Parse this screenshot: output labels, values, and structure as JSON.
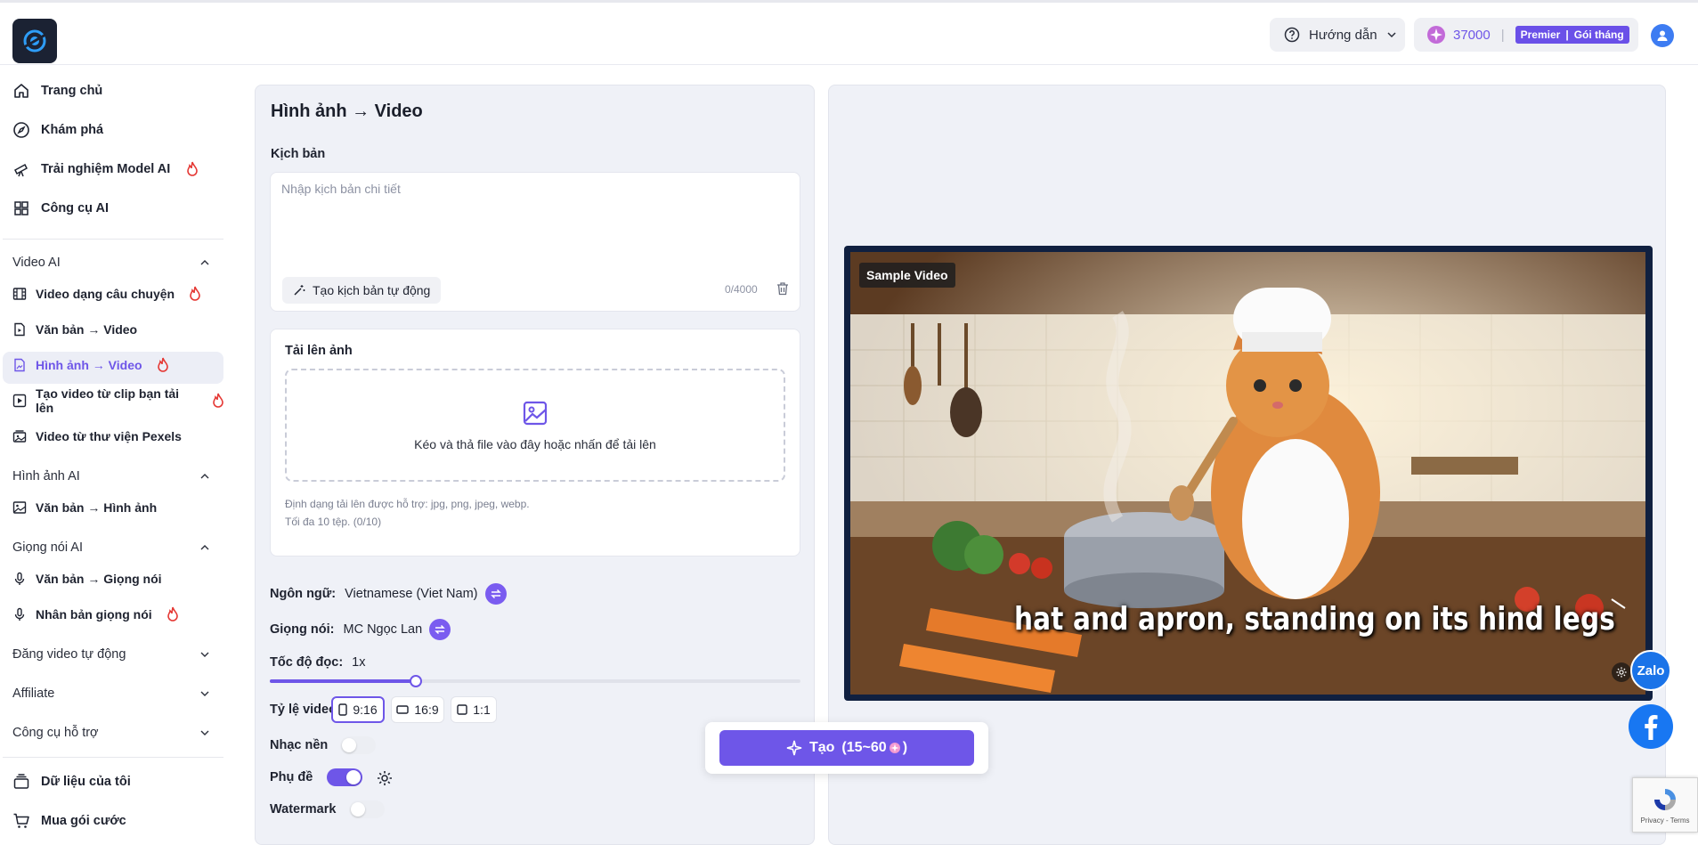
{
  "header": {
    "guide_label": "Hướng dẫn",
    "credits": "37000",
    "plan_tier": "Premier",
    "plan_period": "Gói tháng"
  },
  "sidebar": {
    "top_items": [
      {
        "label": "Trang chủ",
        "icon": "home-icon"
      },
      {
        "label": "Khám phá",
        "icon": "compass-icon"
      },
      {
        "label": "Trải nghiệm Model AI",
        "icon": "telescope-icon",
        "hot": true
      },
      {
        "label": "Công cụ AI",
        "icon": "grid-icon"
      }
    ],
    "sections": [
      {
        "title": "Video AI",
        "expanded": true,
        "items": [
          {
            "label": "Video dạng câu chuyện",
            "hot": true
          },
          {
            "label": "Văn bản → Video"
          },
          {
            "label": "Hình ảnh → Video",
            "active": true,
            "hot": true
          },
          {
            "label": "Tạo video từ clip bạn tải lên",
            "hot": true
          },
          {
            "label": "Video từ thư viện Pexels"
          }
        ]
      },
      {
        "title": "Hình ảnh AI",
        "expanded": true,
        "items": [
          {
            "label": "Văn bản → Hình ảnh"
          }
        ]
      },
      {
        "title": "Giọng nói AI",
        "expanded": true,
        "items": [
          {
            "label": "Văn bản → Giọng nói"
          },
          {
            "label": "Nhân bản giọng nói",
            "hot": true
          }
        ]
      },
      {
        "title": "Đăng video tự động",
        "expanded": false
      },
      {
        "title": "Affiliate",
        "expanded": false
      },
      {
        "title": "Công cụ hỗ trợ",
        "expanded": false
      }
    ],
    "bottom_items": [
      {
        "label": "Dữ liệu của tôi",
        "icon": "database-icon"
      },
      {
        "label": "Mua gói cước",
        "icon": "cart-icon"
      }
    ]
  },
  "form": {
    "title": "Hình ảnh → Video",
    "script_label": "Kịch bản",
    "script_placeholder": "Nhập kịch bản chi tiết",
    "script_value": "",
    "auto_script_label": "Tạo kịch bản tự động",
    "char_count": "0/4000",
    "upload_label": "Tải lên ảnh",
    "dropzone_text": "Kéo và thả file vào đây hoặc nhấn để tải lên",
    "format_hint": "Định dạng tải lên được hỗ trợ: jpg, png, jpeg, webp.",
    "limit_hint": "Tối đa 10 tệp. (0/10)",
    "language_label": "Ngôn ngữ:",
    "language_value": "Vietnamese (Viet Nam)",
    "voice_label": "Giọng nói:",
    "voice_value": "MC Ngọc Lan",
    "speed_label": "Tốc độ đọc:",
    "speed_value": "1x",
    "speed_fraction": 0.275,
    "ratio_label": "Tỷ lệ video",
    "ratios": [
      "9:16",
      "16:9",
      "1:1"
    ],
    "ratio_selected": "9:16",
    "music_label": "Nhạc nền",
    "music_on": false,
    "subtitle_label": "Phụ đề",
    "subtitle_on": true,
    "watermark_label": "Watermark",
    "watermark_on": false
  },
  "preview": {
    "badge": "Sample Video",
    "caption": "hat and apron, standing on its hind legs"
  },
  "create_button": {
    "label": "Tạo",
    "cost": "(15~60",
    "cost_close": ")"
  },
  "widgets": {
    "zalo": "Zalo",
    "recaptcha_text": "Privacy - Terms"
  },
  "colors": {
    "accent": "#6e56e8",
    "hot": "#e53935",
    "panel_bg": "#eff1f7"
  }
}
